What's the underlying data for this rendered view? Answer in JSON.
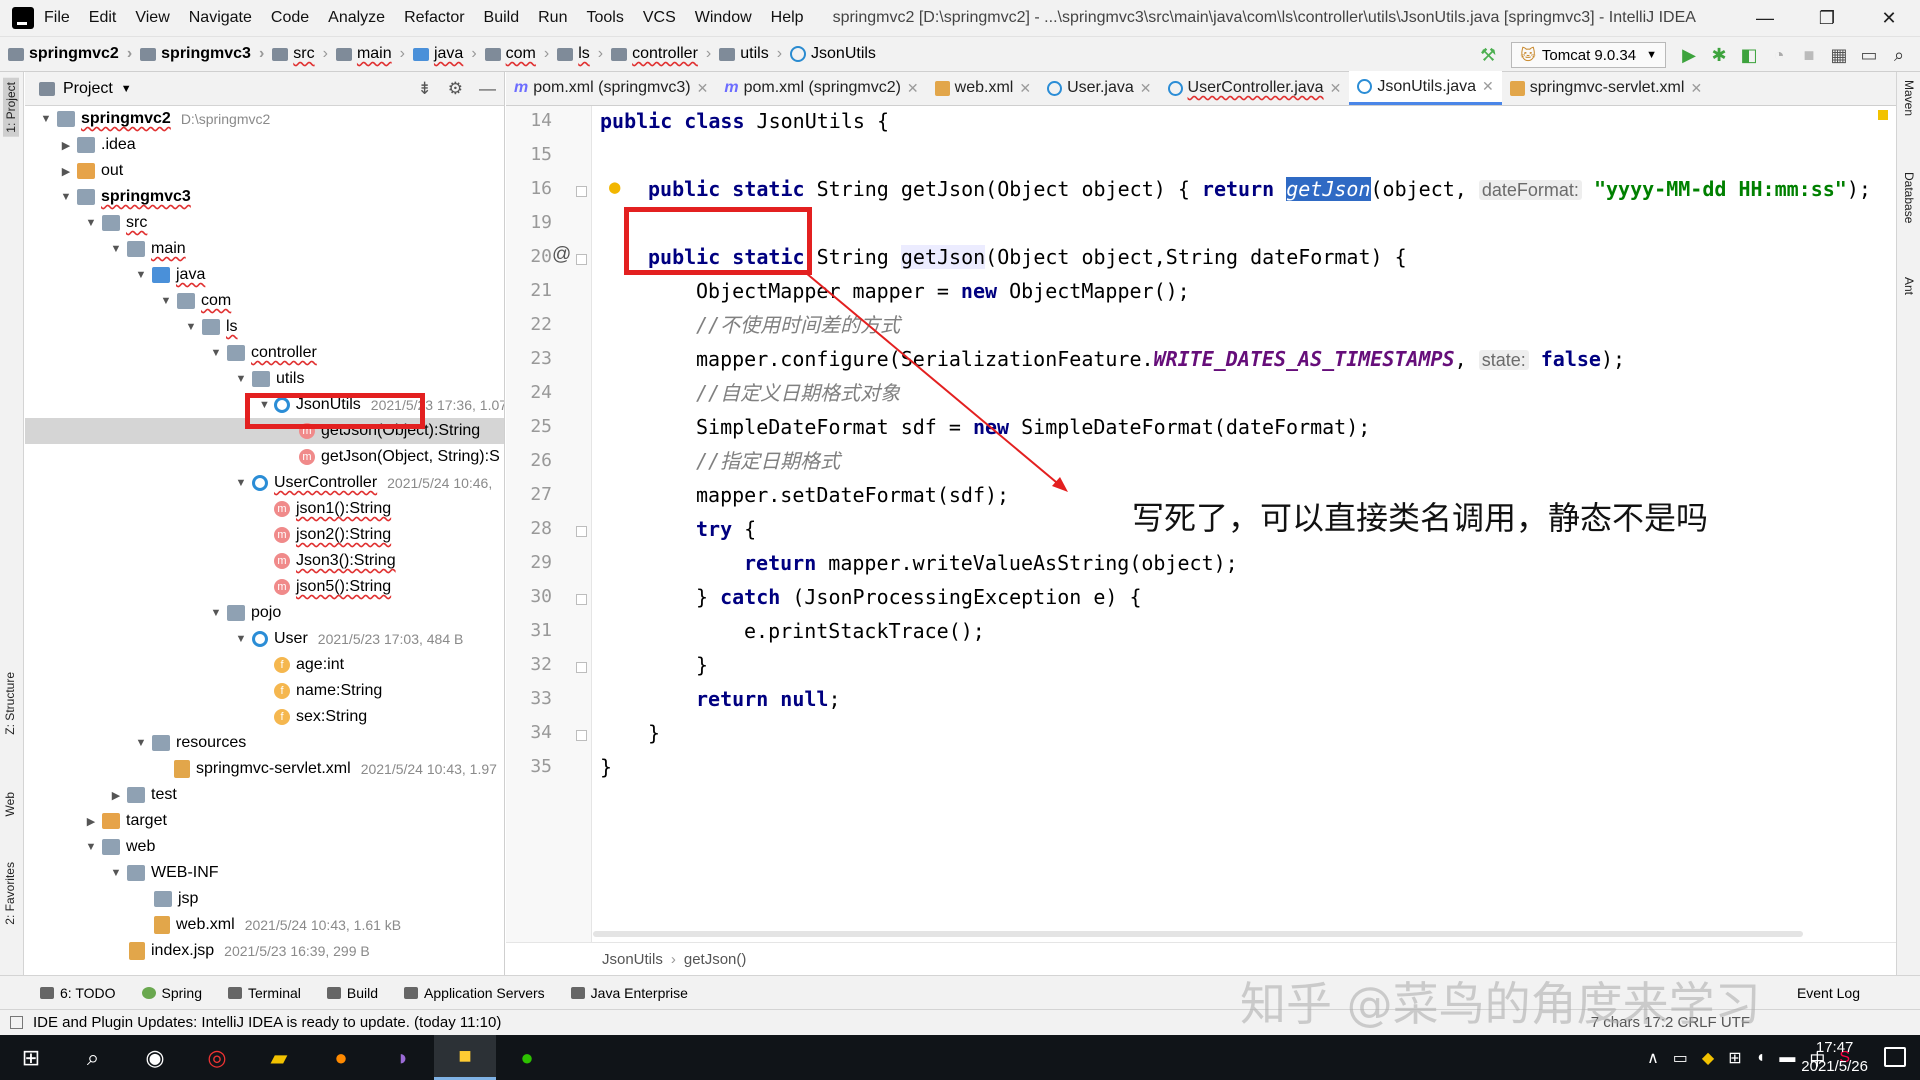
{
  "window": {
    "title": "springmvc2 [D:\\springmvc2] - ...\\springmvc3\\src\\main\\java\\com\\ls\\controller\\utils\\JsonUtils.java [springmvc3] - IntelliJ IDEA",
    "menu": [
      "File",
      "Edit",
      "View",
      "Navigate",
      "Code",
      "Analyze",
      "Refactor",
      "Build",
      "Run",
      "Tools",
      "VCS",
      "Window",
      "Help"
    ],
    "controls": [
      "—",
      "❐",
      "✕"
    ]
  },
  "navbar": {
    "crumbs": [
      "springmvc2",
      "springmvc3",
      "src",
      "main",
      "java",
      "com",
      "ls",
      "controller",
      "utils",
      "JsonUtils"
    ],
    "run_config": "Tomcat 9.0.34"
  },
  "left_strip": {
    "project": "1: Project",
    "structure": "Z: Structure",
    "web": "Web",
    "favorites": "2: Favorites"
  },
  "right_strip": {
    "maven": "Maven",
    "database": "Database",
    "ant": "Ant"
  },
  "project": {
    "title": "Project",
    "tree": [
      {
        "label": "springmvc2",
        "meta": "D:\\springmvc2"
      },
      {
        "label": ".idea",
        "meta": ""
      },
      {
        "label": "out",
        "meta": ""
      },
      {
        "label": "springmvc3",
        "meta": ""
      },
      {
        "label": "src",
        "meta": ""
      },
      {
        "label": "main",
        "meta": ""
      },
      {
        "label": "java",
        "meta": ""
      },
      {
        "label": "com",
        "meta": ""
      },
      {
        "label": "ls",
        "meta": ""
      },
      {
        "label": "controller",
        "meta": ""
      },
      {
        "label": "utils",
        "meta": ""
      },
      {
        "label": "JsonUtils",
        "meta": "2021/5/23 17:36, 1.07"
      },
      {
        "label": "getJson(Object):String",
        "meta": ""
      },
      {
        "label": "getJson(Object, String):S",
        "meta": ""
      },
      {
        "label": "UserController",
        "meta": "2021/5/24 10:46,"
      },
      {
        "label": "json1():String",
        "meta": ""
      },
      {
        "label": "json2():String",
        "meta": ""
      },
      {
        "label": "Json3():String",
        "meta": ""
      },
      {
        "label": "json5():String",
        "meta": ""
      },
      {
        "label": "pojo",
        "meta": ""
      },
      {
        "label": "User",
        "meta": "2021/5/23 17:03, 484 B"
      },
      {
        "label": "age:int",
        "meta": ""
      },
      {
        "label": "name:String",
        "meta": ""
      },
      {
        "label": "sex:String",
        "meta": ""
      },
      {
        "label": "resources",
        "meta": ""
      },
      {
        "label": "springmvc-servlet.xml",
        "meta": "2021/5/24 10:43, 1.97"
      },
      {
        "label": "test",
        "meta": ""
      },
      {
        "label": "target",
        "meta": ""
      },
      {
        "label": "web",
        "meta": ""
      },
      {
        "label": "WEB-INF",
        "meta": ""
      },
      {
        "label": "jsp",
        "meta": ""
      },
      {
        "label": "web.xml",
        "meta": "2021/5/24 10:43, 1.61 kB"
      },
      {
        "label": "index.jsp",
        "meta": "2021/5/23 16:39, 299 B"
      }
    ]
  },
  "tabs": [
    {
      "label": "pom.xml (springmvc3)",
      "icon": "m"
    },
    {
      "label": "pom.xml (springmvc2)",
      "icon": "m"
    },
    {
      "label": "web.xml",
      "icon": "xml"
    },
    {
      "label": "User.java",
      "icon": "class"
    },
    {
      "label": "UserController.java",
      "icon": "class"
    },
    {
      "label": "JsonUtils.java",
      "icon": "class"
    },
    {
      "label": "springmvc-servlet.xml",
      "icon": "xml"
    }
  ],
  "editor": {
    "line_numbers": [
      "14",
      "15",
      "16",
      "19",
      "20",
      "21",
      "22",
      "23",
      "24",
      "25",
      "26",
      "27",
      "28",
      "29",
      "30",
      "31",
      "32",
      "33",
      "34",
      "35"
    ],
    "tokens": {
      "public": "public",
      "class": "class",
      "static": "static",
      "return": "return",
      "new": "new",
      "try": "try",
      "catch": "catch",
      "null": "null",
      "false": "false",
      "l14_rest": " JsonUtils {",
      "l16_a": " String getJson(Object object) { ",
      "l16_call": "getJson",
      "l16_b": "(object, ",
      "l16_hint": "dateFormat:",
      "l16_str": "\"yyyy-MM-dd HH:mm:ss\"",
      "l16_c": ");",
      "l20_a": " String ",
      "l20_name": "getJson",
      "l20_b": "(Object object,String dateFormat) {",
      "l21": "ObjectMapper mapper = ",
      "l21_b": " ObjectMapper();",
      "l22_cm": "//不使用时间差的方式",
      "l23_a": "mapper.configure(SerializationFeature.",
      "l23_const": "WRITE_DATES_AS_TIMESTAMPS",
      "l23_b": ", ",
      "l23_hint": "state:",
      "l23_c": ");",
      "l24_cm": "//自定义日期格式对象",
      "l25_a": "SimpleDateFormat sdf = ",
      "l25_b": " SimpleDateFormat(dateFormat);",
      "l26_cm": "//指定日期格式",
      "l27": "mapper.setDateFormat(sdf);",
      "l28_b": " {",
      "l29_b": " mapper.writeValueAsString(object);",
      "l30_a": "} ",
      "l30_b": " (JsonProcessingException e) {",
      "l31": "e.printStackTrace();",
      "l32": "}",
      "l33_b": ";",
      "l34": "}",
      "l35": "}"
    },
    "breadcrumb": [
      "JsonUtils",
      "getJson()"
    ]
  },
  "annotation": {
    "text": "写死了，可以直接类名调用，静态不是吗",
    "color": "#e32020"
  },
  "tool_buttons": [
    "6: TODO",
    "Spring",
    "Terminal",
    "Build",
    "Application Servers",
    "Java Enterprise"
  ],
  "event_log": "Event Log",
  "status": {
    "message": "IDE and Plugin Updates: IntelliJ IDEA is ready to update. (today 11:10)",
    "right": "7 chars  17:2  CRLF  UTF"
  },
  "watermark": "知乎 @菜鸟的角度来学习",
  "taskbar": {
    "time": "17:47",
    "date": "2021/5/26",
    "ime": "中"
  }
}
